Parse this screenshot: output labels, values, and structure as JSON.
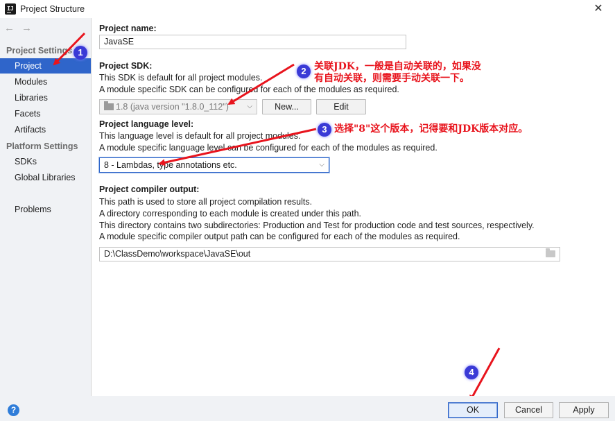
{
  "window": {
    "title": "Project Structure",
    "app_icon": "IJ",
    "close": "✕"
  },
  "nav": {
    "back": "←",
    "forward": "→"
  },
  "sidebar": {
    "project_settings_header": "Project Settings",
    "platform_settings_header": "Platform Settings",
    "items": [
      {
        "label": "Project",
        "active": true
      },
      {
        "label": "Modules"
      },
      {
        "label": "Libraries"
      },
      {
        "label": "Facets"
      },
      {
        "label": "Artifacts"
      }
    ],
    "platform_items": [
      {
        "label": "SDKs"
      },
      {
        "label": "Global Libraries"
      }
    ],
    "problems": "Problems"
  },
  "main": {
    "name_label": "Project name:",
    "name_value": "JavaSE",
    "sdk_label": "Project SDK:",
    "sdk_desc1": "This SDK is default for all project modules.",
    "sdk_desc2": "A module specific SDK can be configured for each of the modules as required.",
    "sdk_value": "1.8 (java version \"1.8.0_112\")",
    "new_button": "New...",
    "edit_button": "Edit",
    "lang_label": "Project language level:",
    "lang_desc1": "This language level is default for all project modules.",
    "lang_desc2": "A module specific language level can be configured for each of the modules as required.",
    "lang_value": "8 - Lambdas, type annotations etc.",
    "out_label": "Project compiler output:",
    "out_desc1": "This path is used to store all project compilation results.",
    "out_desc2": "A directory corresponding to each module is created under this path.",
    "out_desc3": "This directory contains two subdirectories: Production and Test for production code and test sources, respectively.",
    "out_desc4": "A module specific compiler output path can be configured for each of the modules as required.",
    "out_value": "D:\\ClassDemo\\workspace\\JavaSE\\out"
  },
  "annotations": {
    "badge1": "1",
    "badge2": "2",
    "badge3": "3",
    "badge4": "4",
    "note2_line1": "关联JDK，一般是自动关联的，如果没",
    "note2_line2": "有自动关联，则需要手动关联一下。",
    "note3": "选择\"8\"这个版本，记得要和JDK版本对应。",
    "color": "#e8141d"
  },
  "footer": {
    "help": "?",
    "ok": "OK",
    "cancel": "Cancel",
    "apply": "Apply"
  },
  "colors": {
    "accent": "#2f65ca",
    "sidebar_bg": "#f0f2f5",
    "badge": "#3a3ad6"
  }
}
